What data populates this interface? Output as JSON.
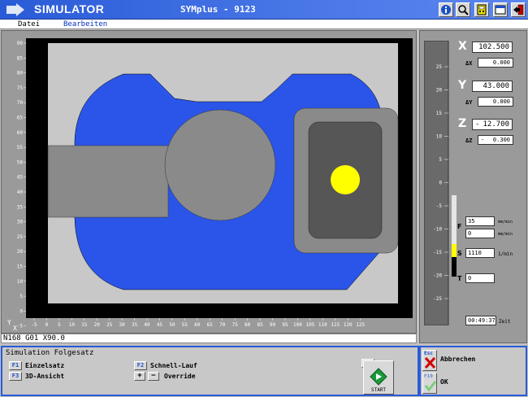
{
  "window": {
    "app_name": "SIMULATOR",
    "center_title": "SYMplus - 9123",
    "title_bar_color": "#2a5bd7",
    "toolbar_icons": [
      "info-icon",
      "zoom-icon",
      "calculator-icon",
      "window-icon",
      "exit-icon"
    ]
  },
  "menu": {
    "datei": "Datei",
    "bearbeiten": "Bearbeiten"
  },
  "plot": {
    "x_axis_label": "X",
    "y_axis_label": "Y",
    "x_ticks": [
      "-5",
      "0",
      "5",
      "10",
      "15",
      "20",
      "25",
      "30",
      "35",
      "40",
      "45",
      "50",
      "55",
      "60",
      "65",
      "70",
      "75",
      "80",
      "85",
      "90",
      "95",
      "100",
      "105",
      "110",
      "115",
      "120",
      "125"
    ],
    "y_ticks": [
      "90",
      "85",
      "80",
      "75",
      "70",
      "65",
      "60",
      "55",
      "50",
      "45",
      "40",
      "35",
      "30",
      "25",
      "20",
      "15",
      "10",
      "5",
      "0",
      "-5"
    ],
    "colors": {
      "workpiece": "#2a55e8",
      "holder": "#8a8a8a",
      "tool": "#ffff00",
      "background": "#c8c8c8",
      "frame": "#000000"
    }
  },
  "status_line": "N168 G01 X90.0",
  "coords": {
    "x": {
      "letter": "X",
      "value": "102.500",
      "delta_label": "ΔX",
      "delta_value": "0.000"
    },
    "y": {
      "letter": "Y",
      "value": "43.000",
      "delta_label": "ΔY",
      "delta_value": "0.000"
    },
    "z": {
      "letter": "Z",
      "sign": "-",
      "value": "12.700",
      "delta_label": "ΔZ",
      "delta_sign": "-",
      "delta_value": "0.300"
    }
  },
  "z_scale": {
    "ticks": [
      "25",
      "20",
      "15",
      "10",
      "5",
      "0",
      "-5",
      "-10",
      "-15",
      "-20",
      "-25"
    ]
  },
  "feed": {
    "letter": "F",
    "value1": "35",
    "unit1": "mm/min",
    "value2": "0",
    "unit2": "mm/min"
  },
  "spindle": {
    "letter": "S",
    "value": "1110",
    "unit": "1/min"
  },
  "tool": {
    "letter": "T",
    "value": "0"
  },
  "time": {
    "value": "00:49:37",
    "label": "Zeit"
  },
  "bottom": {
    "title": "Simulation Folgesatz",
    "f1": {
      "key": "F1",
      "label": "Einzelsatz"
    },
    "f3": {
      "key": "F3",
      "label": "3D-Ansicht"
    },
    "f2": {
      "key": "F2",
      "label": "Schnell-Lauf"
    },
    "plus": "+",
    "minus": "−",
    "override_label": "Override",
    "f8": {
      "key": "F8",
      "label": "START"
    }
  },
  "side": {
    "esc": {
      "key": "Esc",
      "label": "Abbrechen"
    },
    "f10": {
      "key": "F10",
      "label": "OK"
    }
  }
}
